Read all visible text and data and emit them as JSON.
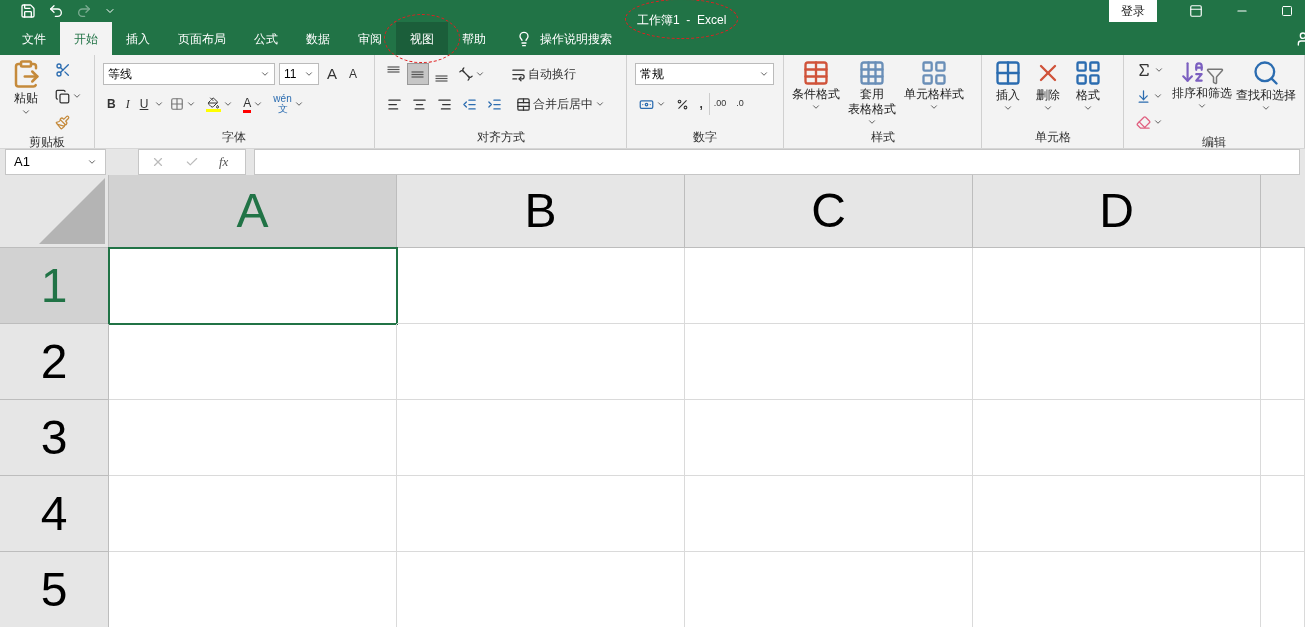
{
  "title": {
    "text": "工作簿1  -  Excel",
    "circled": true
  },
  "login": "登录",
  "tabs": [
    {
      "label": "文件",
      "selected": false,
      "circled": false
    },
    {
      "label": "开始",
      "selected": true,
      "circled": false
    },
    {
      "label": "插入",
      "selected": false,
      "circled": false
    },
    {
      "label": "页面布局",
      "selected": false,
      "circled": false
    },
    {
      "label": "公式",
      "selected": false,
      "circled": false
    },
    {
      "label": "数据",
      "selected": false,
      "circled": false
    },
    {
      "label": "审阅",
      "selected": false,
      "circled": false
    },
    {
      "label": "视图",
      "selected": false,
      "circled": true
    },
    {
      "label": "帮助",
      "selected": false,
      "circled": false
    }
  ],
  "tell_me": "操作说明搜索",
  "ribbon": [
    {
      "kind": "clipboard",
      "label": "剪贴板",
      "paste": "粘贴"
    },
    {
      "kind": "font",
      "label": "字体",
      "font_name": "等线",
      "font_size": "11",
      "grow": "A",
      "shrink": "A",
      "bold": "B",
      "italic": "I",
      "underline": "U",
      "font_color": "A",
      "phonetic_top": "wén",
      "phonetic_bottom": "文"
    },
    {
      "kind": "alignment",
      "label": "对齐方式",
      "vertical": [
        {
          "selected": false
        },
        {
          "selected": true
        },
        {
          "selected": false
        }
      ],
      "wrap": "自动换行",
      "merge": "合并后居中"
    },
    {
      "kind": "number",
      "label": "数字",
      "format": "常规",
      "comma": ",",
      "inc_decimal": ".00",
      "dec_decimal": ".0"
    },
    {
      "kind": "styles",
      "label": "样式",
      "buttons": [
        [
          "条件格式"
        ],
        [
          "套用",
          "表格格式"
        ],
        [
          "单元格样式"
        ]
      ]
    },
    {
      "kind": "cells",
      "label": "单元格",
      "buttons": [
        "插入",
        "删除",
        "格式"
      ]
    },
    {
      "kind": "editing",
      "label": "编辑",
      "buttons": [
        "排序和筛选",
        "查找和选择"
      ]
    }
  ],
  "name_box": "A1",
  "fx": "fx",
  "columns": [
    {
      "label": "A",
      "selected": true
    },
    {
      "label": "B",
      "selected": false
    },
    {
      "label": "C",
      "selected": false
    },
    {
      "label": "D",
      "selected": false
    }
  ],
  "rows": [
    {
      "label": "1",
      "selected": true
    },
    {
      "label": "2",
      "selected": false
    },
    {
      "label": "3",
      "selected": false
    },
    {
      "label": "4",
      "selected": false
    },
    {
      "label": "5",
      "selected": false
    }
  ]
}
